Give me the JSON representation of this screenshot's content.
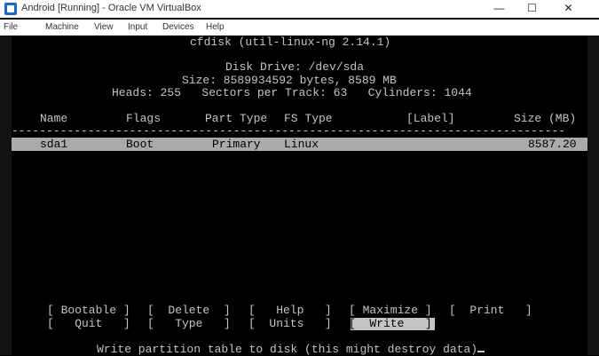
{
  "window": {
    "title": "Android [Running] - Oracle VM VirtualBox",
    "controls": {
      "minimize": "—",
      "maximize": "☐",
      "close": "✕"
    }
  },
  "menu": [
    "File",
    "Machine",
    "View",
    "Input",
    "Devices",
    "Help"
  ],
  "cfdisk": {
    "header": "cfdisk (util-linux-ng 2.14.1)",
    "disk_drive": "Disk Drive: /dev/sda",
    "size_line": "Size: 8589934592 bytes, 8589 MB",
    "geometry": "Heads: 255   Sectors per Track: 63   Cylinders: 1044",
    "columns": {
      "name": "Name",
      "flags": "Flags",
      "part_type": "Part Type",
      "fs_type": "FS Type",
      "label": "[Label]",
      "size": "Size (MB)"
    },
    "separator": "--------------------------------------------------------------------------------",
    "partitions": [
      {
        "name": "sda1",
        "flags": "Boot",
        "part_type": "Primary",
        "fs_type": "Linux",
        "label": "",
        "size": "8587.20"
      }
    ],
    "actions": {
      "bootable": "[ Bootable ]",
      "delete": "[  Delete  ]",
      "help": "[   Help   ]",
      "maximize": "[ Maximize ]",
      "print": "[  Print   ]",
      "quit": "[   Quit   ]",
      "type": "[   Type   ]",
      "units": "[  Units   ]",
      "write": "[  Write   ]"
    },
    "status": "Write partition table to disk (this might destroy data)"
  }
}
